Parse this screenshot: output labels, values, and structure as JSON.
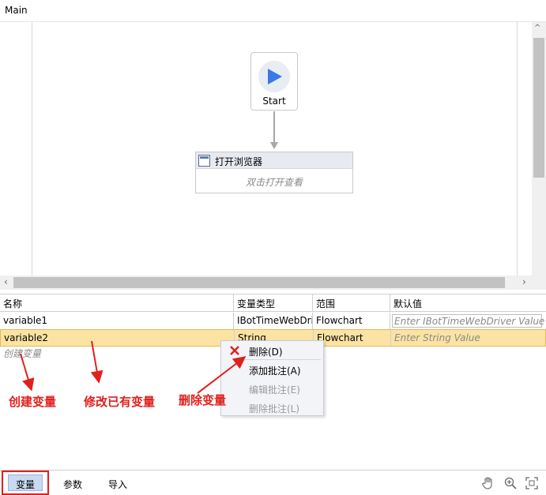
{
  "window": {
    "title": "Main"
  },
  "designer": {
    "start_label": "Start",
    "activity": {
      "title": "打开浏览器",
      "subtitle": "双击打开查看"
    }
  },
  "scrollbars": {
    "left_arrow": "‹",
    "right_arrow": "›",
    "up_arrow": "^"
  },
  "variables_grid": {
    "columns": [
      "名称",
      "变量类型",
      "范围",
      "默认值"
    ],
    "rows": [
      {
        "name": "variable1",
        "type": "IBotTimeWebDriv",
        "scope": "Flowchart",
        "default_placeholder": "Enter IBotTimeWebDriver Value"
      },
      {
        "name": "variable2",
        "type": "String",
        "scope": "Flowchart",
        "default_placeholder": "Enter String Value"
      }
    ],
    "create_label": "创建变量"
  },
  "context_menu": {
    "items": [
      {
        "label": "删除(D)",
        "enabled": true
      },
      {
        "label": "添加批注(A)",
        "enabled": true
      },
      {
        "label": "编辑批注(E)",
        "enabled": false
      },
      {
        "label": "删除批注(L)",
        "enabled": false
      }
    ]
  },
  "annotations": {
    "create": "创建变量",
    "modify": "修改已有变量",
    "delete": "删除变量",
    "color": "#e0201d"
  },
  "bottom_tabs": {
    "variables": "变量",
    "arguments": "参数",
    "imports": "导入"
  },
  "toolbar_icons": [
    "hand-pan-icon",
    "zoom-in-icon",
    "fit-screen-icon"
  ],
  "colors": {
    "selected_row": "#fbe3a3",
    "accent": "#3b78e7"
  }
}
